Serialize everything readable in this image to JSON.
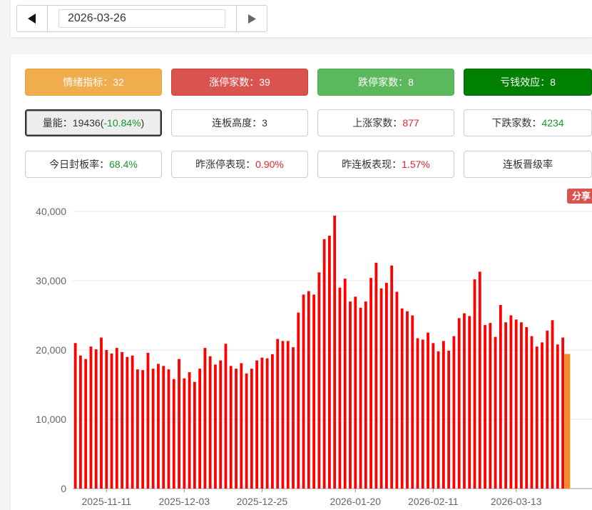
{
  "nav": {
    "prev_icon": "triangle-left-icon",
    "next_icon": "triangle-right-icon",
    "date_value": "2026-03-26"
  },
  "cards": {
    "sentiment": {
      "label": "情绪指标：",
      "value": "32"
    },
    "limit_up": {
      "label": "涨停家数：",
      "value": "39"
    },
    "limit_down": {
      "label": "跌停家数：",
      "value": "8"
    },
    "loss_effect": {
      "label": "亏钱效应：",
      "value": "8"
    },
    "volume": {
      "label": "量能：",
      "value_plain": "19436(",
      "value_change": "-10.84%",
      "value_close": ")"
    },
    "consecutive_height": {
      "label": "连板高度：",
      "value": "3"
    },
    "up_count": {
      "label": "上涨家数：",
      "value": "877"
    },
    "down_count": {
      "label": "下跌家数：",
      "value": "4234"
    },
    "seal_rate": {
      "label": "今日封板率：",
      "value": "68.4%"
    },
    "yesterday_limit_perf": {
      "label": "昨涨停表现：",
      "value": "0.90%"
    },
    "yesterday_consec_perf": {
      "label": "昨连板表现：",
      "value": "1.57%"
    },
    "promotion_rate": {
      "label": "连板晋级率"
    }
  },
  "share_label": "分享",
  "colors": {
    "bar": "#ff0000",
    "bar_highlight": "#f28c28",
    "orange": "#f0ad4e",
    "red": "#d9534f",
    "light_green": "#5cb85c",
    "dark_green": "#008000",
    "value_red": "#e4252d",
    "value_green": "#15962e"
  },
  "chart_data": {
    "type": "bar",
    "y_ticks": [
      "0",
      "10,000",
      "20,000",
      "30,000",
      "40,000"
    ],
    "ylim": [
      0,
      40000
    ],
    "x_tick_labels": [
      "2025-11-11",
      "2025-12-03",
      "2025-12-25",
      "2026-01-20",
      "2026-02-11",
      "2026-03-13"
    ],
    "grid": true,
    "highlight_last": true,
    "values": [
      21000,
      19200,
      18700,
      20500,
      20100,
      21800,
      20000,
      19500,
      20300,
      19700,
      19000,
      19200,
      17200,
      17100,
      19600,
      17300,
      18000,
      17700,
      17200,
      15800,
      18700,
      15900,
      16800,
      15400,
      17300,
      20300,
      19100,
      17900,
      18500,
      20900,
      17700,
      17300,
      18100,
      16600,
      17300,
      18500,
      18900,
      18800,
      19400,
      21600,
      21300,
      21300,
      20400,
      25400,
      28000,
      28500,
      28000,
      31200,
      36000,
      36500,
      39400,
      29000,
      30300,
      27000,
      27700,
      26100,
      27000,
      30400,
      32600,
      28900,
      29700,
      32200,
      28400,
      26000,
      25600,
      25000,
      21700,
      21500,
      22500,
      21000,
      19800,
      21300,
      19900,
      22000,
      24600,
      25300,
      24900,
      30200,
      31300,
      23600,
      23900,
      21900,
      26500,
      24000,
      25000,
      24400,
      24000,
      23300,
      22000,
      20500,
      21100,
      22800,
      24300,
      20800,
      21800,
      19436
    ]
  }
}
